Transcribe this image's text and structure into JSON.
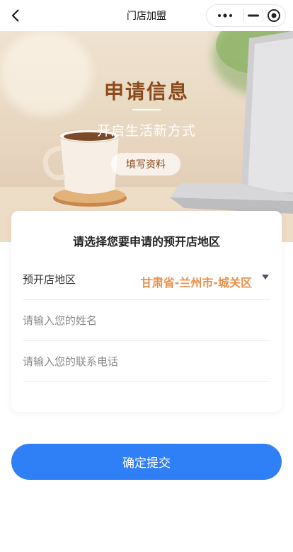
{
  "navbar": {
    "title": "门店加盟",
    "back_icon": "chevron-left-icon",
    "more_icon": "more-dots-icon",
    "minimize_icon": "minimize-icon",
    "close_icon": "target-circle-icon"
  },
  "banner": {
    "title": "申请信息",
    "subtitle": "开启生活新方式",
    "fill_button": "填写资料"
  },
  "form": {
    "heading": "请选择您要申请的预开店地区",
    "region_label": "预开店地区",
    "region_value": "甘肃省-兰州市-城关区",
    "name_placeholder": "请输入您的姓名",
    "phone_placeholder": "请输入您的联系电话"
  },
  "submit_label": "确定提交",
  "colors": {
    "accent": "#2f7ff6",
    "title_brown": "#8b4a1c",
    "region_orange": "#e8904a"
  }
}
